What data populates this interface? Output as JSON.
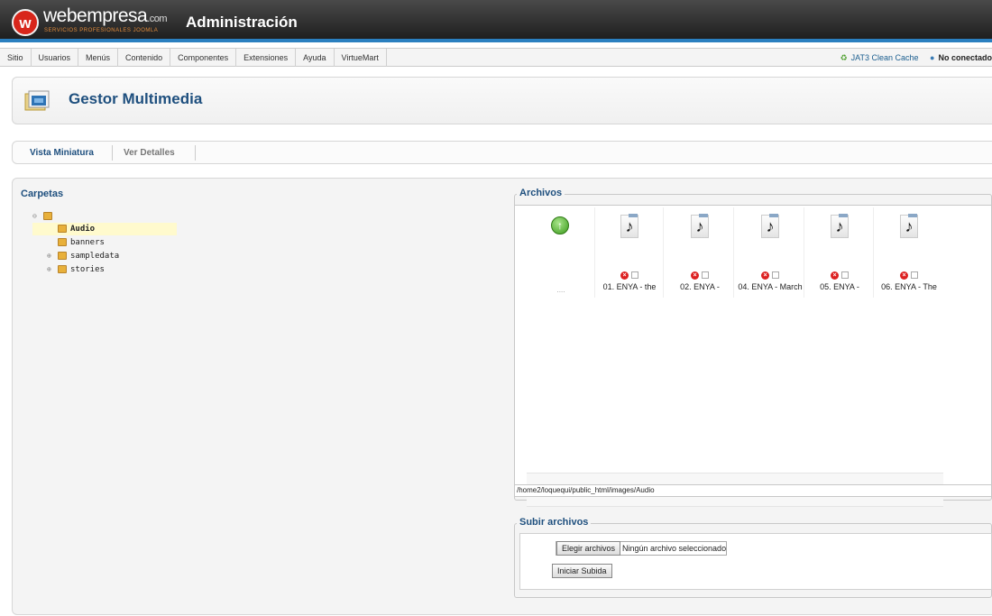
{
  "header": {
    "logo_mark": "w",
    "logo_name": "webempresa",
    "logo_com": ".com",
    "logo_tagline": "SERVICIOS PROFESIONALES JOOMLA",
    "title": "Administración"
  },
  "menu": {
    "items": [
      "Sitio",
      "Usuarios",
      "Menús",
      "Contenido",
      "Componentes",
      "Extensiones",
      "Ayuda",
      "VirtueMart"
    ],
    "cache_label": "JAT3 Clean Cache",
    "status_label": "No conectado"
  },
  "page": {
    "title": "Gestor Multimedia"
  },
  "tabs": {
    "thumbnail": "Vista Miniatura",
    "details": "Ver Detalles"
  },
  "folders": {
    "title": "Carpetas",
    "tree": [
      {
        "label": "Audio",
        "selected": true
      },
      {
        "label": "banners"
      },
      {
        "label": "sampledata"
      },
      {
        "label": "stories"
      }
    ]
  },
  "files": {
    "title": "Archivos",
    "up_label": "....",
    "items": [
      {
        "name": "01. ENYA - the"
      },
      {
        "name": "02. ENYA -"
      },
      {
        "name": "04. ENYA - March"
      },
      {
        "name": "05. ENYA -"
      },
      {
        "name": "06. ENYA - The"
      }
    ],
    "path": "/home2/loquequi/public_html/images/Audio"
  },
  "upload": {
    "title": "Subir archivos",
    "browse_label": "Elegir archivos",
    "no_file": "Ningún archivo seleccionado",
    "start_label": "Iniciar Subida"
  },
  "colors": {
    "accent_blue": "#1e4f7e",
    "header_bar": "#2a7fbf",
    "logo_red": "#d8261b",
    "selected_row": "#fffacd"
  }
}
